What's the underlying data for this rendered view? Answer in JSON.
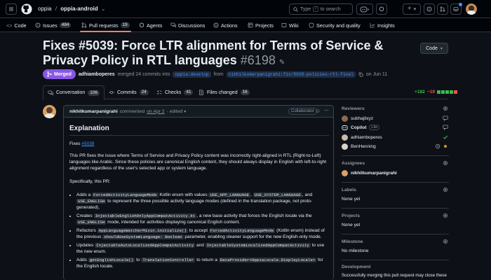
{
  "header": {
    "owner": "oppia",
    "separator": "/",
    "repo": "oppia-android",
    "search_placeholder_prefix": "Type",
    "search_key": "/",
    "search_placeholder_suffix": "to search",
    "new_label": "+"
  },
  "repo_nav": {
    "items": [
      {
        "label": "Code"
      },
      {
        "label": "Issues",
        "count": "484"
      },
      {
        "label": "Pull requests",
        "count": "19"
      },
      {
        "label": "Agents"
      },
      {
        "label": "Discussions"
      },
      {
        "label": "Actions"
      },
      {
        "label": "Projects"
      },
      {
        "label": "Wiki"
      },
      {
        "label": "Security and quality"
      },
      {
        "label": "Insights"
      }
    ]
  },
  "pr": {
    "title": "Fixes #5039: Force LTR alignment for Terms of Service & Privacy Policy in RTL languages",
    "number": "#6198",
    "code_button": "Code",
    "state": "Merged",
    "merger": "adhiamboperes",
    "merge_text": "merged 24 commits into",
    "base_branch": "oppia:develop",
    "from_text": "from",
    "head_branch": "nikhilkumarpanigrahi:fix/5039-policies-rtl-final",
    "date": "on Jun 11"
  },
  "tabs": [
    {
      "label": "Conversation",
      "count": "106"
    },
    {
      "label": "Commits",
      "count": "24"
    },
    {
      "label": "Checks",
      "count": "41"
    },
    {
      "label": "Files changed",
      "count": "16"
    }
  ],
  "diffstat": {
    "additions": "+182",
    "deletions": "−19"
  },
  "comment": {
    "author": "nikhilkumarpanigrahi",
    "action": "commented",
    "date": "on Apr 2",
    "edited": "· edited",
    "role": "Collaborator",
    "heading": "Explanation",
    "fixes_prefix": "Fixes",
    "fixes_link": "#5039",
    "para1": "This PR fixes the issue where Terms of Service and Privacy Policy content was incorrectly right-aligned in RTL (Right-to-Left) languages like Arabic. Since these policies are canonical English content, they should always display in English with left-to-right alignment regardless of the user's selected app or system language.",
    "para2": "Specifically, this PR:",
    "b1_t1": "Adds a",
    "b1_c1": "ForcedActivityLanguageMode",
    "b1_t2": "Kotlin enum with values",
    "b1_c2": "USE_APP_LANGUAGE",
    "b1_t3": ",",
    "b1_c3": "USE_SYSTEM_LANGUAGE",
    "b1_t4": ", and",
    "b1_c4": "USE_ENGLISH",
    "b1_t5": "to represent the three possible activity language modes (defined in the translation package, not proto-generated).",
    "b2_t1": "Creates",
    "b2_c1": "InjectableEnglishOnlyAppCompatActivity.kt",
    "b2_t2": ", a new base activity that forces the English locale via the",
    "b2_c2": "USE_ENGLISH",
    "b2_t3": "mode, intended for activities displaying canonical English content.",
    "b3_t1": "Refactors",
    "b3_c1": "AppLanguageWatcherMixin.initialize()",
    "b3_t2": "to accept",
    "b3_c2": "ForcedActivityLanguageMode",
    "b3_t3": "(Kotlin enum) instead of the previous",
    "b3_c3": "shouldUseSystemLanguage: Boolean",
    "b3_t4": "parameter, enabling cleaner support for the new English-only mode.",
    "b4_t1": "Updates",
    "b4_c1": "InjectableAutoLocalizedAppCompatActivity",
    "b4_t2": "and",
    "b4_c2": "InjectableSystemLocalizedAppCompatActivity",
    "b4_t3": "to use the new enum.",
    "b5_t1": "Adds",
    "b5_c1": "getEnglishLocale()",
    "b5_t2": "to",
    "b5_c2": "TranslationController",
    "b5_t3": "to return a",
    "b5_c3": "DataProvider<OppiaLocale.DisplayLocale>",
    "b5_t4": "for the English locale."
  },
  "sidebar": {
    "reviewers_label": "Reviewers",
    "reviewers": [
      {
        "name": "subhajitxyz"
      },
      {
        "name": "Copilot",
        "badge": "Lite"
      },
      {
        "name": "adhiamboperes"
      },
      {
        "name": "BenHenning"
      }
    ],
    "assignees_label": "Assignees",
    "assignee": "nikhilkumarpanigrahi",
    "labels_label": "Labels",
    "labels_value": "None yet",
    "projects_label": "Projects",
    "projects_value": "None yet",
    "milestone_label": "Milestone",
    "milestone_value": "No milestone",
    "development_label": "Development",
    "development_value": "Successfully merging this pull request may close these"
  },
  "colors": {
    "background": "#0d1117",
    "accent_tab": "#f78166",
    "merged": "#8957e5",
    "link": "#4493f8",
    "additions": "#3fb950",
    "deletions": "#f85149"
  }
}
